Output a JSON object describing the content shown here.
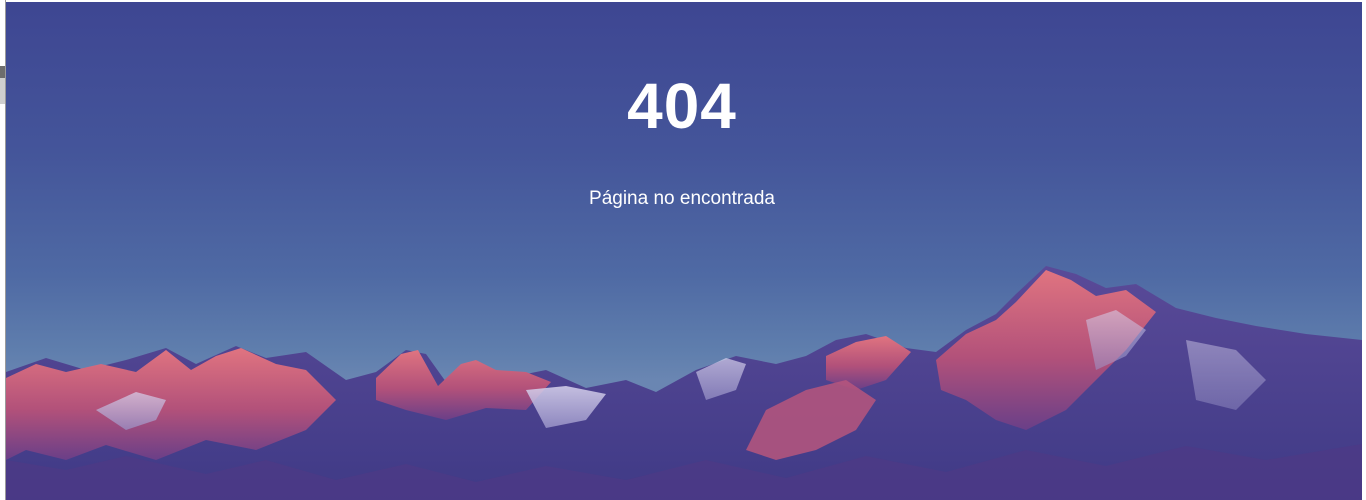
{
  "error": {
    "code": "404",
    "message": "Página no encontrada"
  },
  "background": {
    "description_icon": "mountain-landscape",
    "colors": {
      "sky_top": "#3e4692",
      "sky_bottom": "#6a86b2",
      "peaks_lit": "#d8667a",
      "peaks_shadow": "#4a3f8c",
      "snow": "#c9c6e6"
    }
  }
}
